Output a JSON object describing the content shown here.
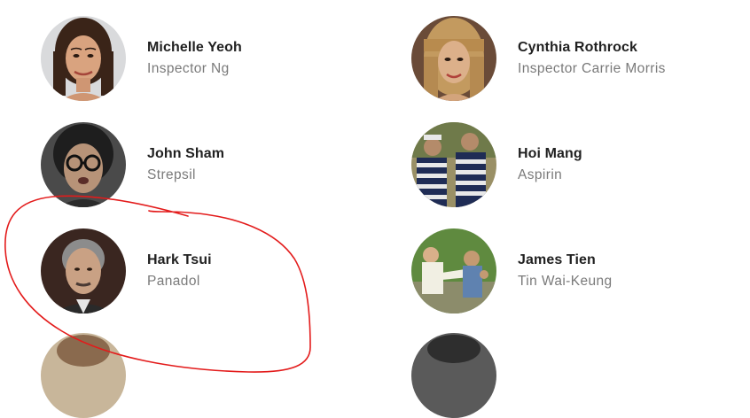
{
  "cast": [
    {
      "name": "Michelle Yeoh",
      "role": "Inspector Ng"
    },
    {
      "name": "Cynthia Rothrock",
      "role": "Inspector Carrie Morris"
    },
    {
      "name": "John Sham",
      "role": "Strepsil"
    },
    {
      "name": "Hoi Mang",
      "role": "Aspirin"
    },
    {
      "name": "Hark Tsui",
      "role": "Panadol"
    },
    {
      "name": "James Tien",
      "role": "Tin Wai-Keung"
    }
  ],
  "annotation": {
    "color": "#e31b1b",
    "shape": "hand-drawn-circle"
  }
}
